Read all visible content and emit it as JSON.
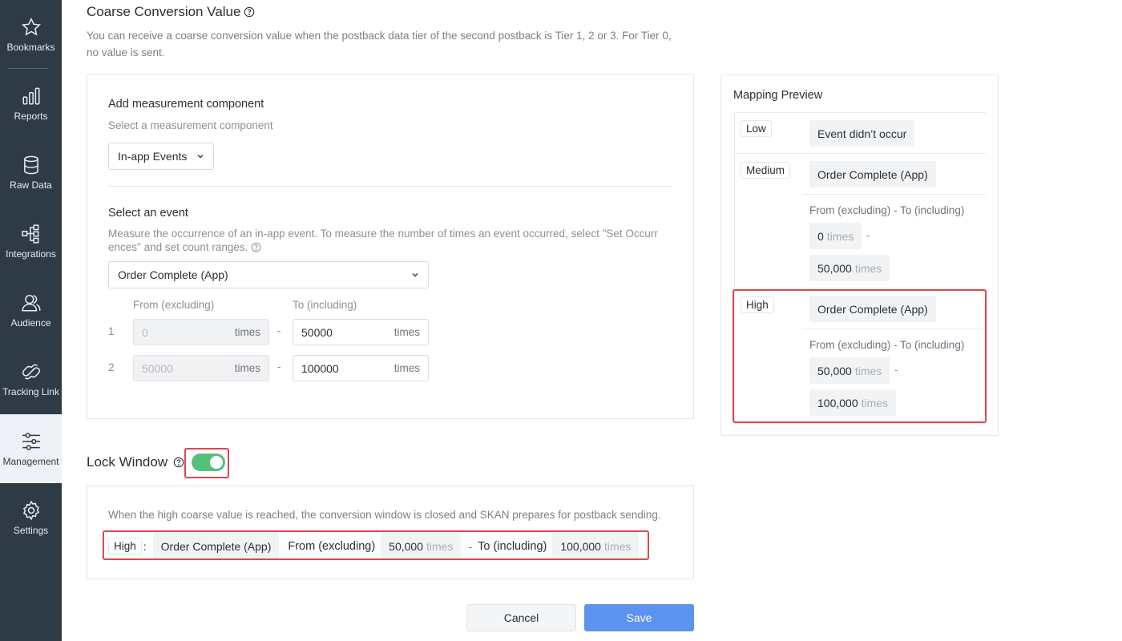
{
  "sidebar": {
    "items": [
      {
        "label": "Bookmarks",
        "icon": "star-icon"
      },
      {
        "label": "Reports",
        "icon": "bar-chart-icon"
      },
      {
        "label": "Raw Data",
        "icon": "database-icon"
      },
      {
        "label": "Integrations",
        "icon": "integrations-icon"
      },
      {
        "label": "Audience",
        "icon": "audience-icon"
      },
      {
        "label": "Tracking Link",
        "icon": "link-icon"
      },
      {
        "label": "Management",
        "icon": "sliders-icon",
        "active": true
      },
      {
        "label": "Settings",
        "icon": "gear-icon"
      }
    ]
  },
  "coarse": {
    "title": "Coarse Conversion Value",
    "description_line1": "You can receive a coarse conversion value when the postback data tier of the second postback is Tier 1, 2 or 3. For Tier 0,",
    "description_line2": "no value is sent."
  },
  "component": {
    "title": "Add measurement component",
    "subtitle": "Select a measurement component",
    "selected": "In-app Events"
  },
  "event": {
    "title": "Select an event",
    "description_line1": "Measure the occurrence of an in-app event. To measure the number of times an event occurred, select \"Set Occurr",
    "description_line2": "ences\" and set count ranges.",
    "selected": "Order Complete (App)",
    "from_header": "From (excluding)",
    "to_header": "To (including)",
    "dash": "-",
    "unit": "times",
    "rows": [
      {
        "index": "1",
        "from": "0",
        "to": "50000"
      },
      {
        "index": "2",
        "from": "50000",
        "to": "100000"
      }
    ]
  },
  "preview": {
    "title": "Mapping Preview",
    "range_label": "From (excluding) - To (including)",
    "unit": "times",
    "dash": "-",
    "low": {
      "tag": "Low",
      "event": "Event didn’t occur"
    },
    "medium": {
      "tag": "Medium",
      "event": "Order Complete (App)",
      "from": "0",
      "to": "50,000"
    },
    "high": {
      "tag": "High",
      "event": "Order Complete (App)",
      "from": "50,000",
      "to": "100,000"
    }
  },
  "lock": {
    "title": "Lock Window",
    "enabled": true,
    "toggle_color": "#52c17a",
    "description": "When the high coarse value is reached, the conversion window is closed and SKAN prepares for postback sending.",
    "tag": "High",
    "colon": ":",
    "event": "Order Complete (App)",
    "from_label": "From (excluding)",
    "from_value": "50,000",
    "dash": "-",
    "to_label": "To (including)",
    "to_value": "100,000",
    "unit": "times"
  },
  "actions": {
    "cancel": "Cancel",
    "save": "Save",
    "save_color": "#5b93ee"
  },
  "highlight_color": "#e0464f"
}
